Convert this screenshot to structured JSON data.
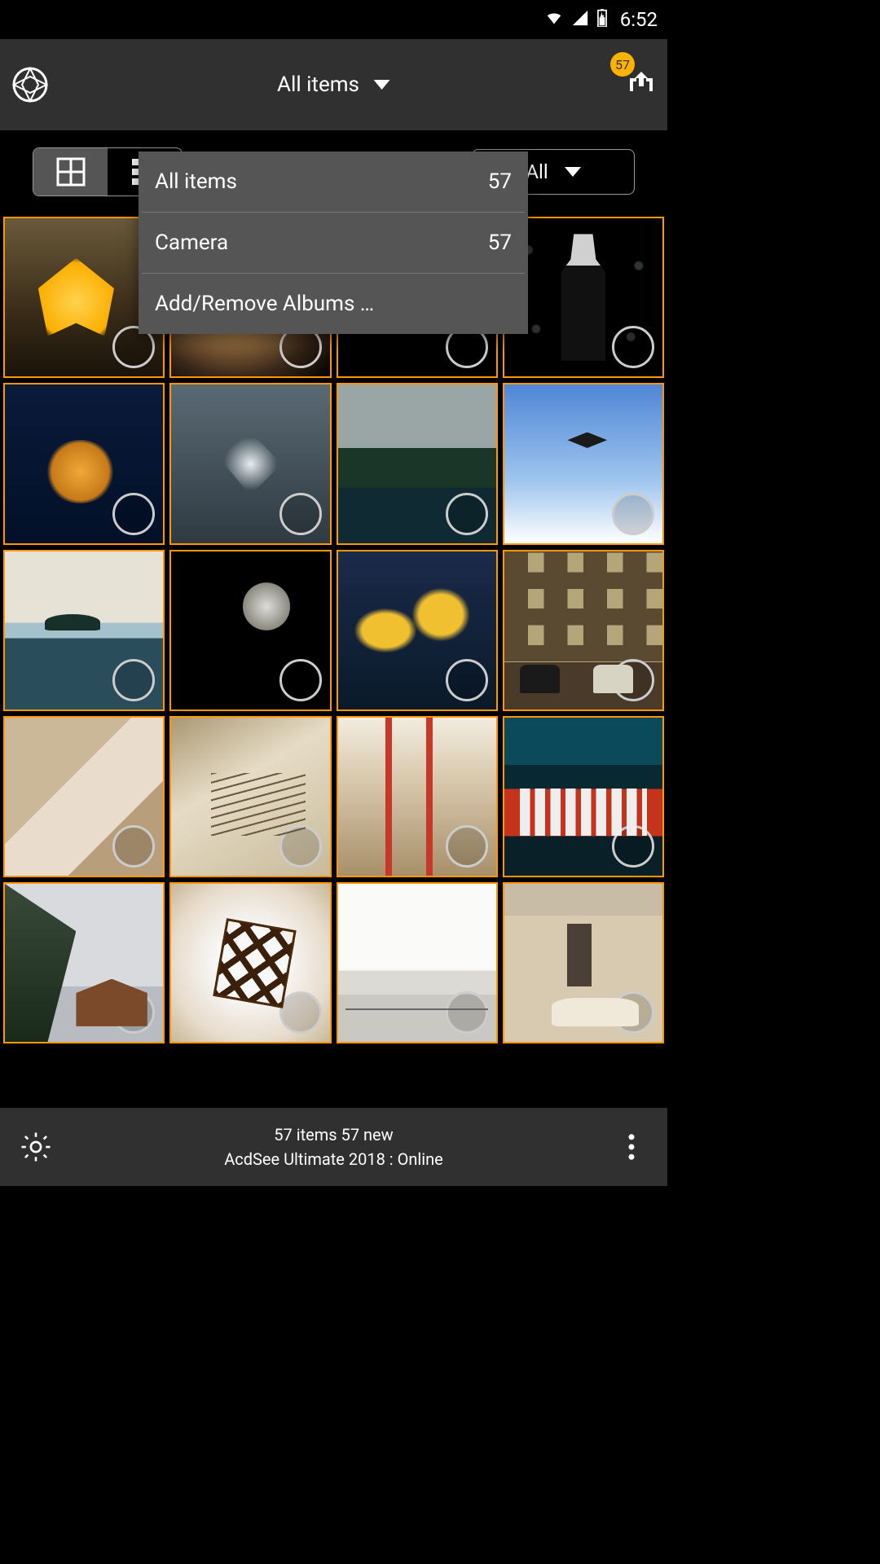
{
  "status_bar": {
    "time": "6:52"
  },
  "header": {
    "dropdown_label": "All items",
    "upload_badge": "57"
  },
  "toolbar": {
    "filter_label": "All"
  },
  "dropdown": {
    "items": [
      {
        "label": "All items",
        "count": "57"
      },
      {
        "label": "Camera",
        "count": "57"
      },
      {
        "label": "Add/Remove Albums …",
        "count": ""
      }
    ]
  },
  "footer": {
    "line1": "57 items  57 new",
    "line2": "AcdSee Ultimate 2018 : Online"
  }
}
